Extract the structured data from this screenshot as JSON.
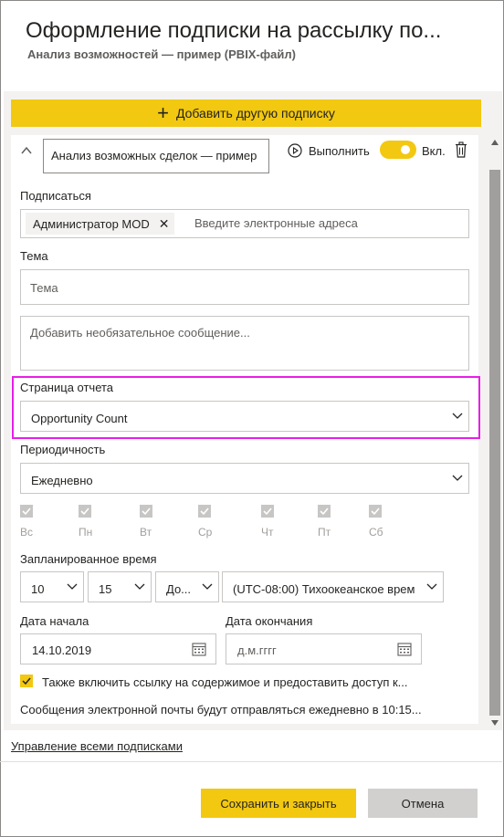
{
  "header": {
    "title": "Оформление подписки на рассылку по...",
    "subtitle": "Анализ возможностей — пример (PBIX-файл)"
  },
  "add_subscription": {
    "label": "Добавить другую подписку",
    "icon": "plus-icon"
  },
  "subscription": {
    "report_name": "Анализ возможных сделок — пример",
    "run_label": "Выполнить",
    "toggle_label": "Вкл.",
    "toggle_on": true,
    "subscribe_label": "Подписаться",
    "recipient": "Администратор MOD",
    "recipients_placeholder": "Введите электронные адреса",
    "subject_label": "Тема",
    "subject_placeholder": "Тема",
    "message_placeholder": "Добавить необязательное сообщение...",
    "report_page_label": "Страница отчета",
    "report_page_value": "Opportunity Count",
    "frequency_label": "Периодичность",
    "frequency_value": "Ежедневно",
    "days": [
      {
        "label": "Вс",
        "checked": true
      },
      {
        "label": "Пн",
        "checked": true
      },
      {
        "label": "Вт",
        "checked": true
      },
      {
        "label": "Ср",
        "checked": true
      },
      {
        "label": "Чт",
        "checked": true
      },
      {
        "label": "Пт",
        "checked": true
      },
      {
        "label": "Сб",
        "checked": true
      }
    ],
    "scheduled_time_label": "Запланированное время",
    "hour": "10",
    "minute": "15",
    "ampm": "До...",
    "timezone": "(UTC-08:00) Тихоокеанское врем",
    "start_date_label": "Дата начала",
    "start_date_value": "14.10.2019",
    "end_date_label": "Дата окончания",
    "end_date_placeholder": "д.м.гггг",
    "share_label": "Также включить ссылку на содержимое и предоставить доступ к...",
    "share_checked": true,
    "schedule_note": "Сообщения электронной почты будут отправляться ежедневно в 10:15..."
  },
  "footer": {
    "manage_link": "Управление всеми подписками",
    "save_label": "Сохранить и закрыть",
    "cancel_label": "Отмена"
  },
  "colors": {
    "accent": "#f2c811",
    "highlight": "#e81ee8",
    "panel_bg": "#f3f2f1"
  }
}
